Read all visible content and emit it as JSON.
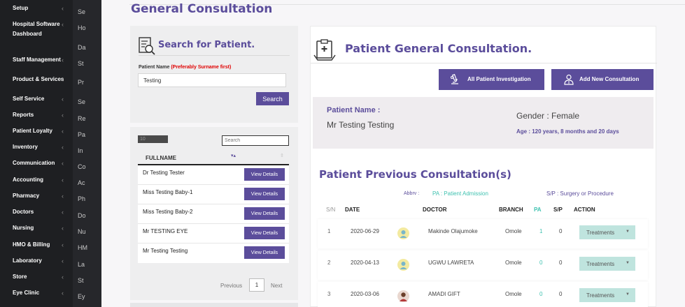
{
  "sidebar": {
    "items": [
      {
        "label": "Setup",
        "abbr": "Se"
      },
      {
        "label": "Hospital Software Dashboard",
        "abbr": "Ho"
      },
      {
        "label": "",
        "abbr": "Da"
      },
      {
        "label": "Staff Management",
        "abbr": "St"
      },
      {
        "label": "Product & Services",
        "abbr": "Pr"
      },
      {
        "label": "Self Service",
        "abbr": "Se"
      },
      {
        "label": "Reports",
        "abbr": "Re"
      },
      {
        "label": "Patient Loyalty",
        "abbr": "Pa"
      },
      {
        "label": "Inventory",
        "abbr": "In"
      },
      {
        "label": "Communication",
        "abbr": "Co"
      },
      {
        "label": "Accounting",
        "abbr": "Ac"
      },
      {
        "label": "Pharmacy",
        "abbr": "Ph"
      },
      {
        "label": "Doctors",
        "abbr": "Do"
      },
      {
        "label": "Nursing",
        "abbr": "Nu"
      },
      {
        "label": "HMO & Billing",
        "abbr": "HM"
      },
      {
        "label": "Laboratory",
        "abbr": "La"
      },
      {
        "label": "Store",
        "abbr": "St"
      },
      {
        "label": "Eye Clinic",
        "abbr": "Ey"
      }
    ]
  },
  "page_title": "General Consultation",
  "search": {
    "title": "Search for Patient.",
    "label": "Patient Name",
    "label_hint": "(Preferably Surname first)",
    "value": "Testing",
    "button": "Search"
  },
  "patient_list": {
    "page_length": "10",
    "search_placeholder": "Search",
    "column": "FULLNAME",
    "rows": [
      {
        "name": "Dr Testing Tester",
        "action": "View Details"
      },
      {
        "name": "Miss Testing Baby-1",
        "action": "View Details"
      },
      {
        "name": "Miss Testing Baby-2",
        "action": "View Details"
      },
      {
        "name": "Mr TESTING EYE",
        "action": "View Details"
      },
      {
        "name": "Mr Testing Testing",
        "action": "View Details"
      }
    ],
    "pagination": {
      "previous": "Previous",
      "current": "1",
      "next": "Next"
    }
  },
  "consultation": {
    "title": "Patient General Consultation.",
    "btn_investigation": "All Patient Investigation",
    "btn_add": "Add New Consultation",
    "patient_name_label": "Patient Name :",
    "patient_name": "Mr Testing Testing",
    "gender": "Gender : Female",
    "age": "Age : 120 years, 8 months and 20 days",
    "previous_title": "Patient Previous Consultation(s)",
    "abbrv": "Abbrv :",
    "pa_legend": "PA : Patient Admission",
    "sp_legend": "S/P : Surgery or Procedure",
    "headers": {
      "sn": "S/N",
      "date": "DATE",
      "doctor": "DOCTOR",
      "branch": "BRANCH",
      "pa": "PA",
      "sp": "S/P",
      "action": "ACTION"
    },
    "rows": [
      {
        "sn": "1",
        "date": "2020-06-29",
        "doctor": "Makinde Olajumoke",
        "branch": "Omole",
        "pa": "1",
        "sp": "0",
        "action": "Treatments"
      },
      {
        "sn": "2",
        "date": "2020-04-13",
        "doctor": "UGWU LAWRETA",
        "branch": "Omole",
        "pa": "0",
        "sp": "0",
        "action": "Treatments"
      },
      {
        "sn": "3",
        "date": "2020-03-06",
        "doctor": "AMADI GIFT",
        "branch": "Omole",
        "pa": "0",
        "sp": "0",
        "action": "Treatments"
      }
    ]
  },
  "colors": {
    "accent": "#5b4d9b",
    "teal": "#3fc2b0",
    "sidebar": "#1e1f22",
    "required": "#e00000"
  },
  "icons": [
    "search-document-icon",
    "medical-clipboard-icon",
    "microscope-icon",
    "doctor-add-icon",
    "chevron-left-icon",
    "avatar-icon",
    "caret-down-icon"
  ]
}
